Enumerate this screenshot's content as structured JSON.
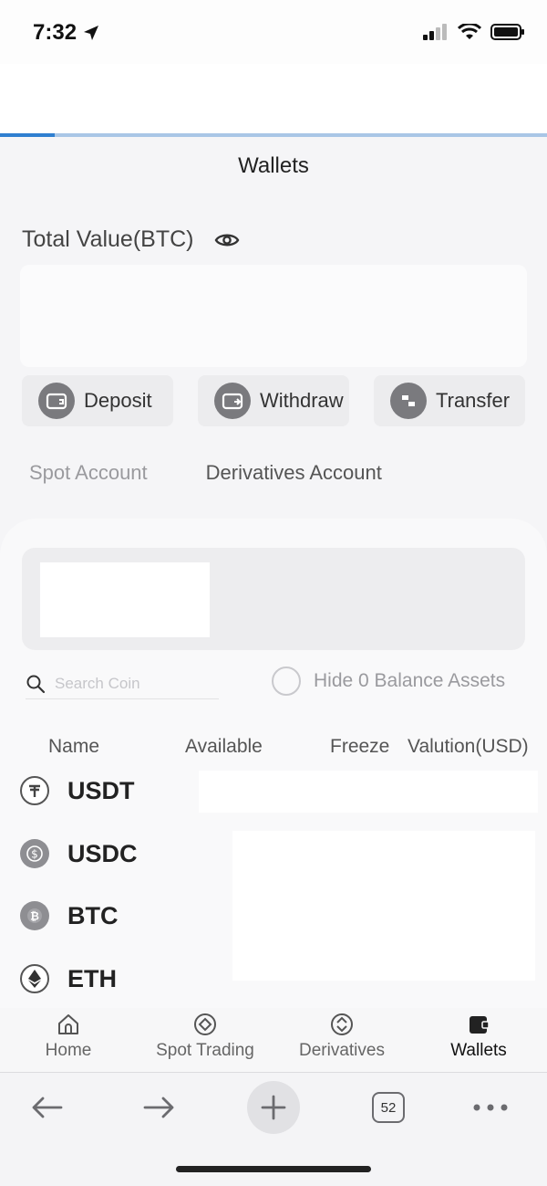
{
  "status_bar": {
    "time": "7:32"
  },
  "page": {
    "title": "Wallets"
  },
  "total": {
    "label": "Total Value(BTC)"
  },
  "actions": {
    "deposit": "Deposit",
    "withdraw": "Withdraw",
    "transfer": "Transfer"
  },
  "account_tabs": {
    "spot": "Spot Account",
    "derivatives": "Derivatives Account"
  },
  "search": {
    "placeholder": "Search Coin",
    "hide_zero_label": "Hide 0 Balance Assets"
  },
  "table": {
    "columns": [
      "Name",
      "Available",
      "Freeze",
      "Valution(USD)"
    ],
    "coins": [
      "USDT",
      "USDC",
      "BTC",
      "ETH"
    ]
  },
  "bottom_nav": {
    "home": "Home",
    "spot": "Spot Trading",
    "derivatives": "Derivatives",
    "wallets": "Wallets"
  },
  "browser": {
    "tabs_count": "52",
    "load_progress": 0.1
  },
  "colors": {
    "progress": "#2f7fd0",
    "icon_gray": "#7a7a7e"
  }
}
